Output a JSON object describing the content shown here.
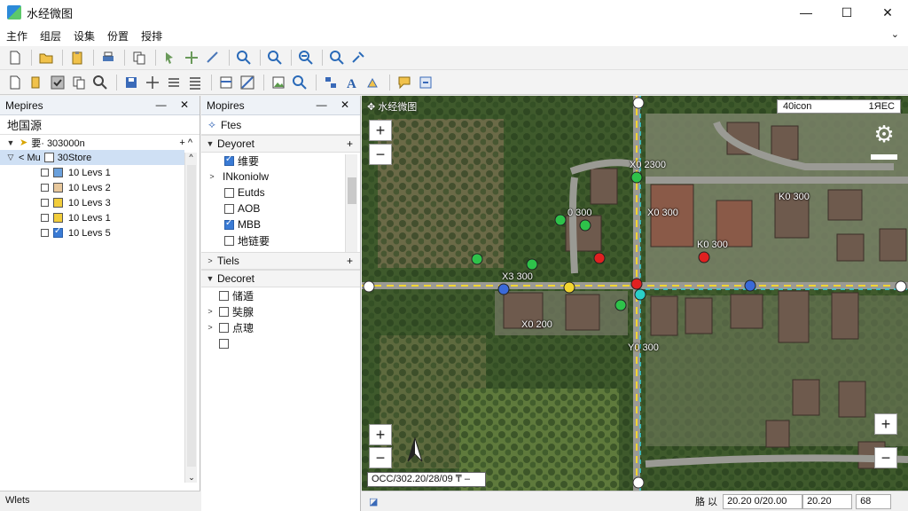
{
  "window": {
    "title": "水经微图",
    "minimize": "—",
    "maximize": "☐",
    "close": "✕"
  },
  "menu": {
    "items": [
      "主作",
      "组层",
      "设集",
      "份置",
      "授排"
    ],
    "chevron": "⌄"
  },
  "layers_panel": {
    "title": "Mepires",
    "subheader": "地国源",
    "scale_row": {
      "arrow": "▼",
      "label": "要·  303000n",
      "controls": "+  ^"
    },
    "root_row": {
      "label": "Mu",
      "sublabel": "30Store"
    },
    "layers": [
      {
        "label": "10 Levs 1",
        "color": "#6aa0dc",
        "checked": false
      },
      {
        "label": "10 Levs 2",
        "color": "#e8c89c",
        "checked": false
      },
      {
        "label": "10 Levs 3",
        "color": "#f2cd3b",
        "checked": false
      },
      {
        "label": "10 Levs 1",
        "color": "#f2cd3b",
        "checked": false
      },
      {
        "label": "10 Levs 5",
        "color": "#3a7bd5",
        "checked": true
      }
    ],
    "status": "Wlets"
  },
  "mid_panel": {
    "title": "Mopires",
    "search": "Ftes",
    "sections": [
      {
        "label": "Deyoret",
        "arrow": "▼",
        "plus": "+"
      },
      {
        "label": "Tiels",
        "arrow": ">",
        "plus": "+"
      },
      {
        "label": "Decoret",
        "arrow": "▼",
        "plus": ""
      }
    ],
    "deyoret_items": [
      {
        "label": "维要",
        "checked": true,
        "arrow": ""
      },
      {
        "label": "INkoniolw",
        "checked": false,
        "arrow": ">",
        "nobox": true
      },
      {
        "label": "Eutds",
        "checked": false,
        "arrow": ""
      },
      {
        "label": "AOB",
        "checked": false,
        "arrow": ""
      },
      {
        "label": "MBB",
        "checked": true,
        "arrow": ""
      },
      {
        "label": "地链要",
        "checked": false,
        "arrow": ""
      }
    ],
    "decoret_items": [
      {
        "label": "储遁",
        "arrow": ""
      },
      {
        "label": "奘腺",
        "arrow": ">"
      },
      {
        "label": "点璁",
        "arrow": ">"
      },
      {
        "label": "",
        "arrow": ""
      }
    ]
  },
  "map": {
    "title": "水经微图",
    "scale": {
      "left": "40icon",
      "right": "1ЯEC"
    },
    "coords_readout": "OCC/302.20/28/09 ₸  –",
    "labels": [
      "X0  2300",
      "0  300",
      "X0  300",
      "K0  300",
      "K0  300",
      "X3  300",
      "X0  200",
      "Y0  300"
    ],
    "zoom_in": "+",
    "zoom_out": "−"
  },
  "statusbar": {
    "left_icon": "◪",
    "coords_label": "胳 以",
    "coords": "20.20  0/20.00",
    "time": "20.20",
    "zoom": "68"
  }
}
